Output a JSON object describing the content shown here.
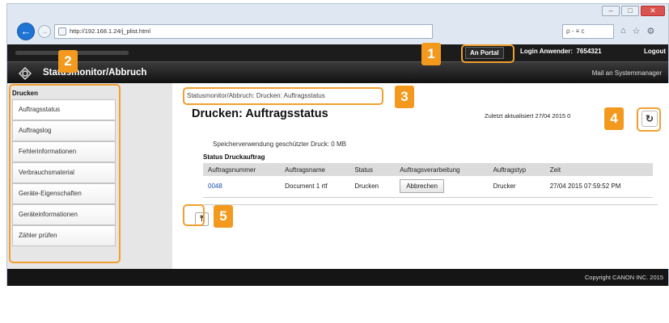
{
  "browser": {
    "address": "http://192.168.1.24/j_plist.html",
    "address_host": "192.168.1.24",
    "search_placeholder": "ρ - ≡ c",
    "window_buttons": [
      "–",
      "□",
      "✕"
    ],
    "toolbar_icons": [
      "home-icon",
      "star-icon",
      "settings-icon"
    ]
  },
  "header": {
    "portal_label": "An Portal",
    "login_label": "Login Anwender:",
    "login_user": "7654321",
    "logout_label": "Logout",
    "title": "Statusmonitor/Abbruch",
    "mail_label": "Mail an Systemmanager"
  },
  "sidebar": {
    "heading": "Drucken",
    "items": [
      {
        "label": "Auftragsstatus"
      },
      {
        "label": "Auftragslog"
      },
      {
        "label": "Fehlerinformationen"
      },
      {
        "label": "Verbrauchsmaterial"
      },
      {
        "label": "Geräte-Eigenschaften"
      },
      {
        "label": "Geräteinformationen"
      },
      {
        "label": "Zähler prüfen"
      }
    ]
  },
  "main": {
    "breadcrumb": "Statusmonitor/Abbruch: Drucken: Auftragsstatus",
    "title": "Drucken: Auftragsstatus",
    "updated": "Zuletzt aktualisiert 27/04 2015 0",
    "memory": "Speicherverwendung geschützter Druck:   0 MB",
    "section_title": "Status Druckauftrag",
    "columns": [
      "Auftragsnummer",
      "Auftragsname",
      "Status",
      "Auftragsverarbeitung",
      "Auftragstyp",
      "Zeit"
    ],
    "rows": [
      {
        "number": "0048",
        "name": "Document 1 rtf",
        "status": "Drucken",
        "action": "Abbrechen",
        "type": "Drucker",
        "time": "27/04 2015 07:59:52 PM"
      }
    ]
  },
  "footer": {
    "copyright": "Copyright CANON INC. 2015"
  },
  "callouts": [
    "1",
    "2",
    "3",
    "4",
    "5"
  ],
  "colors": {
    "callout": "#f39a1e",
    "header_bg": "#1c1c1c",
    "link": "#1a50b0"
  }
}
